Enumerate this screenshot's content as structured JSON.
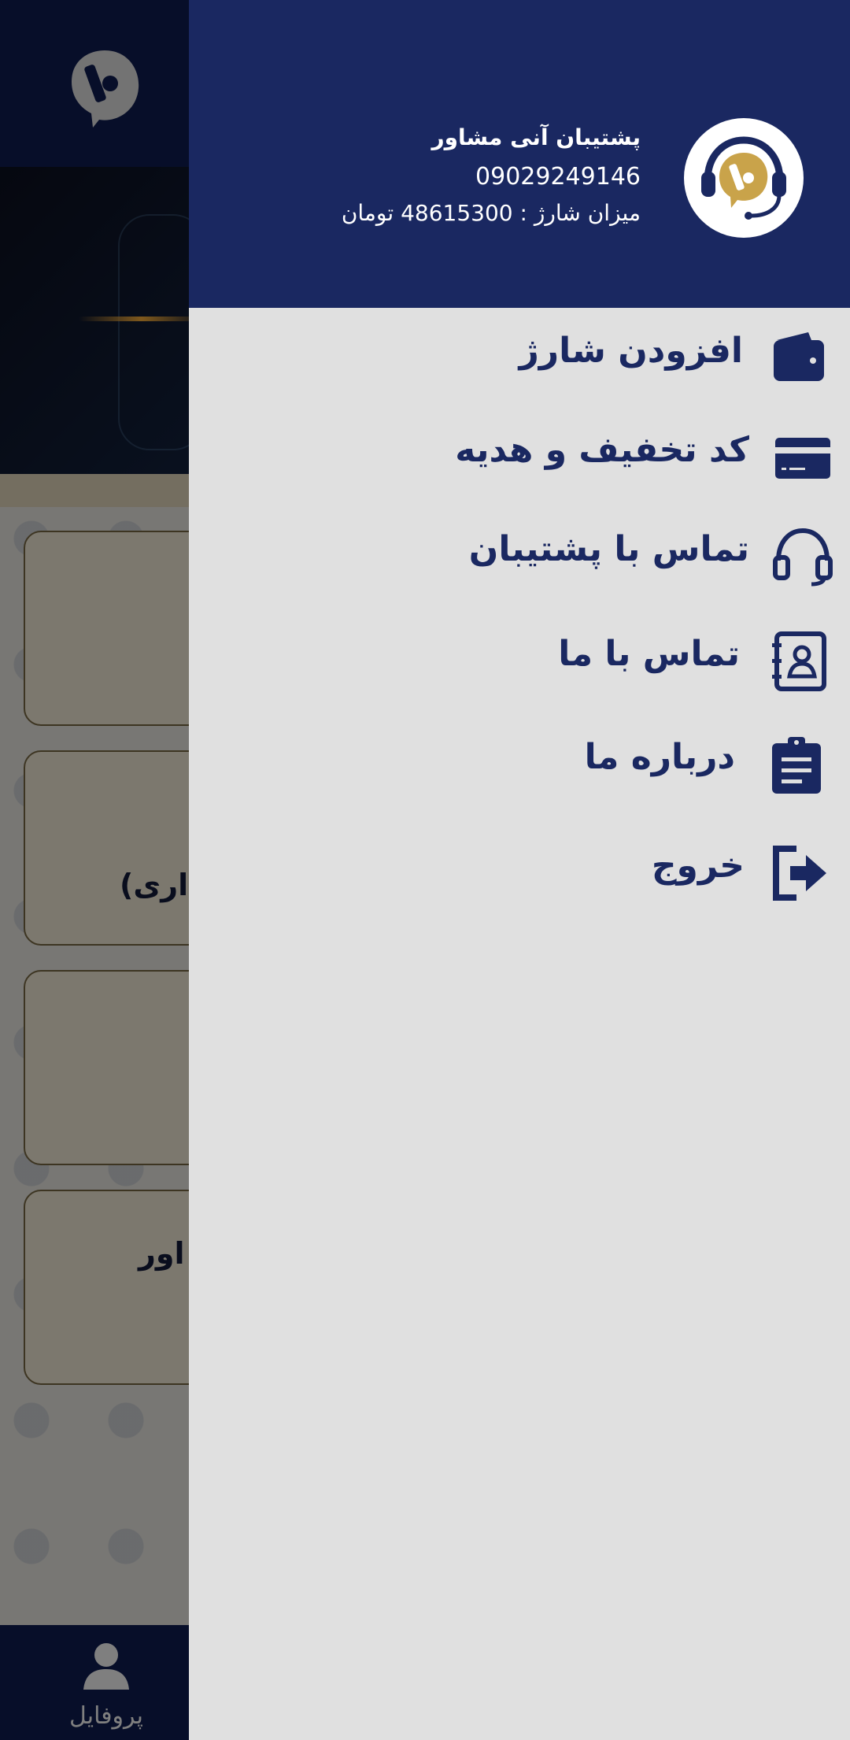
{
  "background_app": {
    "card_texts": [
      "داری)",
      "اور"
    ],
    "bottom_nav_label": "پروفایل"
  },
  "drawer": {
    "header": {
      "user_name": "پشتیبان آنی مشاور",
      "phone": "09029249146",
      "balance": "میزان شارژ : 48615300 تومان"
    },
    "menu": [
      {
        "label": "افزودن شارژ",
        "icon": "wallet-icon"
      },
      {
        "label": "کد تخفیف و هدیه",
        "icon": "credit-card-icon"
      },
      {
        "label": "تماس با پشتیبان",
        "icon": "headset-icon"
      },
      {
        "label": "تماس با ما",
        "icon": "contact-book-icon"
      },
      {
        "label": "درباره ما",
        "icon": "clipboard-icon"
      },
      {
        "label": "خروج",
        "icon": "logout-icon"
      }
    ]
  },
  "colors": {
    "drawer_header": "#1a2861",
    "drawer_body": "#e0e0e0",
    "accent_text": "#1a2861",
    "logo_gold": "#c9a34a"
  }
}
